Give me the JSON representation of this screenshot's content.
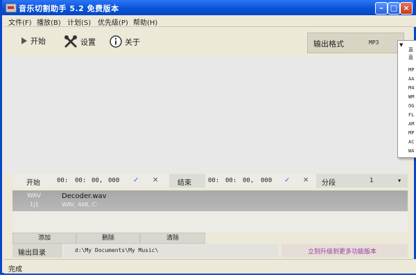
{
  "window": {
    "title": "音乐切割助手 5.2 免费版本",
    "minimize": "–",
    "maximize": "□",
    "close": "×"
  },
  "menu": [
    {
      "label": "文件(F)"
    },
    {
      "label": "播放(B)"
    },
    {
      "label": "计划(S)"
    },
    {
      "label": "优先级(P)"
    },
    {
      "label": "帮助(H)"
    }
  ],
  "toolbar": {
    "start": "开始",
    "settings": "设置",
    "about": "关于"
  },
  "format": {
    "label": "输出格式",
    "value": "MP3"
  },
  "format_dropdown": {
    "arrow": "▼",
    "items": [
      "直",
      "直",
      "MP",
      "AA",
      "M4",
      "WM",
      "OG",
      "FL",
      "AM",
      "MP",
      "AC",
      "WA"
    ]
  },
  "time_controls": {
    "start_label": "开始",
    "start_h": "00:",
    "start_m": "00:",
    "start_s": "00,",
    "start_ms": "000",
    "end_label": "结束",
    "end_h": "00:",
    "end_m": "00:",
    "end_s": "00,",
    "end_ms": "000",
    "confirm_glyph": "✓",
    "clear_glyph": "✕",
    "segment_label": "分段",
    "segment_value": "1",
    "segment_arrow": "▼"
  },
  "file": {
    "type": "WAV",
    "name": "Decoder.wav",
    "index": "1|1",
    "info": "WAV, 468, C:"
  },
  "buttons": {
    "add": "添加",
    "delete": "删除",
    "clear": "清除"
  },
  "output": {
    "label": "输出目录",
    "path": "d:\\My Documents\\My Music\\",
    "upgrade": "立刻升级到更多功能版本"
  },
  "status": {
    "text": "完成"
  }
}
